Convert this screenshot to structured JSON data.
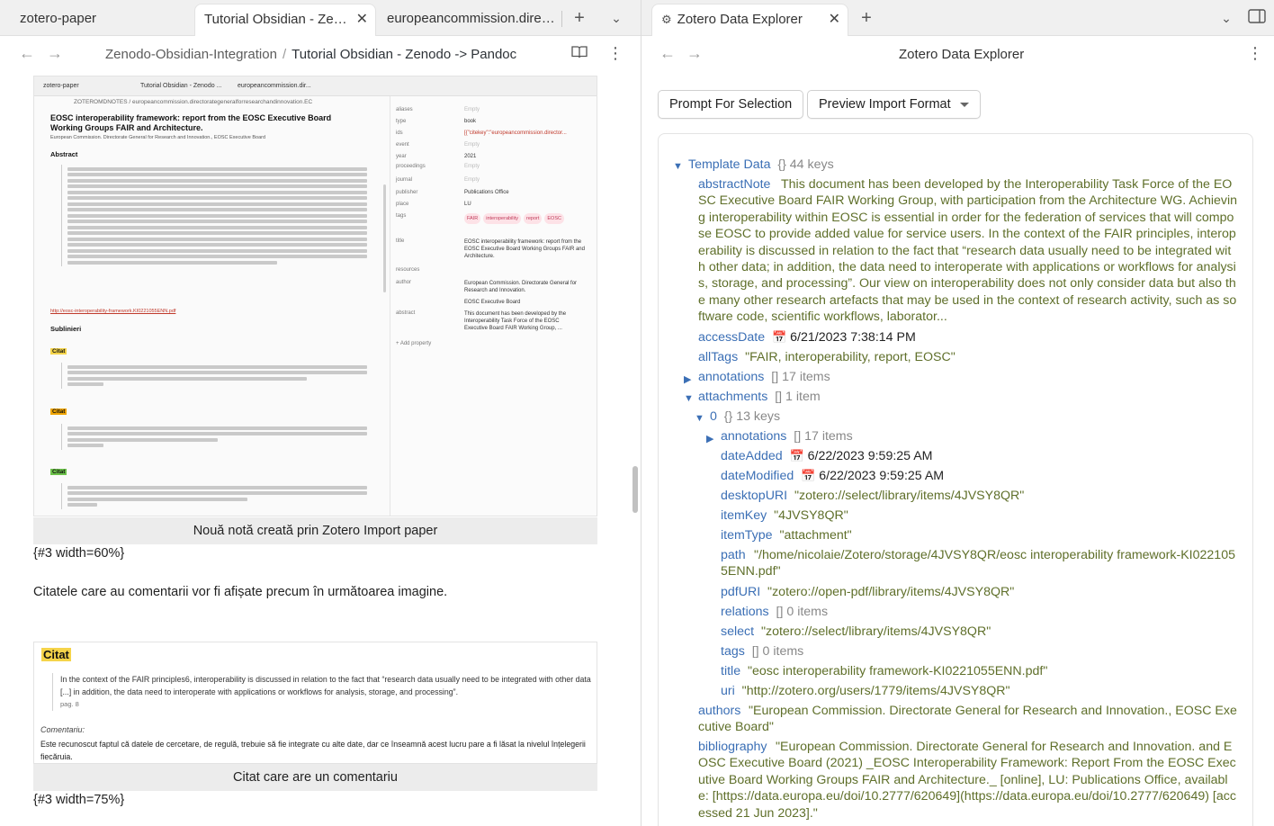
{
  "left": {
    "tabs": [
      {
        "label": "zotero-paper"
      },
      {
        "label": "Tutorial Obsidian - Zenodo -> Pandoc"
      },
      {
        "label": "europeancommission.directorategeneralforresearchandinnovation"
      }
    ],
    "breadcrumb": {
      "folder": "Zenodo-Obsidian-Integration",
      "separator": "/",
      "note": "Tutorial Obsidian - Zenodo -> Pandoc"
    },
    "mini": {
      "tabs": [
        "zotero-paper",
        "Tutorial Obsidian - Zenodo ...",
        "europeancommission.dir..."
      ],
      "crumb": "ZOTEROMDNOTES / europeancommission.directorategeneralforresearchandinnovation.EC",
      "title": "EOSC interoperability framework: report from the EOSC Executive Board Working Groups FAIR and Architecture.",
      "authors": "European Commission. Directorate General for Research and Innovation., EOSC Executive Board",
      "abstract_h": "Abstract",
      "link": "http://eosc-interoperability-framework.KI0221055ENN.pdf",
      "sublinieri": "Sublinieri",
      "citat": "Citat",
      "props": [
        {
          "name": "aliases",
          "value": "Empty"
        },
        {
          "name": "type",
          "value": "book"
        },
        {
          "name": "ids",
          "value": "[{\"citekey\":\"europeancommission.director..."
        },
        {
          "name": "event",
          "value": "Empty"
        },
        {
          "name": "year",
          "value": "2021"
        },
        {
          "name": "proceedings",
          "value": "Empty"
        },
        {
          "name": "journal",
          "value": "Empty"
        },
        {
          "name": "publisher",
          "value": "Publications Office"
        },
        {
          "name": "place",
          "value": "LU"
        },
        {
          "name": "tags",
          "value": ""
        },
        {
          "name": "title",
          "value": "EOSC interoperability framework: report from the EOSC Executive Board Working Groups FAIR and Architecture."
        },
        {
          "name": "resources",
          "value": ""
        },
        {
          "name": "author",
          "value": "European Commission. Directorate General for Research and Innovation."
        },
        {
          "name": "abstract",
          "value": "This document has been developed by the Interoperability Task Force of the EOSC Executive Board FAIR Working Group, ..."
        }
      ],
      "tags": [
        "FAIR",
        "interoperability",
        "report",
        "EOSC"
      ],
      "author2": "EOSC Executive Board",
      "add_property": "+ Add property"
    },
    "caption1": "Nouă notă creată prin Zotero Import paper",
    "width1": "{#3 width=60%}",
    "paragraph": "Citatele care au comentarii vor fi afișate precum în următoarea imagine.",
    "quote_card": {
      "label": "Citat",
      "text": "In the context of the FAIR principles6, interoperability is discussed in relation to the fact that “research data usually need to be integrated with other data [...] in addition, the data need to interoperate with applications or workflows for analysis, storage, and processing”.",
      "page": "pag. 8",
      "comment_label": "Comentariu:",
      "comment": "Este recunoscut faptul că datele de cercetare, de regulă, trebuie să fie integrate cu alte date, dar ce înseamnă acest lucru pare a fi lăsat la nivelul înțelegerii fiecăruia."
    },
    "caption2": "Citat care are un comentariu",
    "width2": "{#3 width=75%}"
  },
  "right": {
    "tab": {
      "label": "Zotero Data Explorer"
    },
    "title": "Zotero Data Explorer",
    "buttons": {
      "prompt": "Prompt For Selection",
      "preview": "Preview Import Format"
    },
    "tree": {
      "root_key": "Template Data",
      "root_meta": "{}  44 keys",
      "abstractNote_key": "abstractNote",
      "abstractNote_val": "This document has been developed by the Interoperability Task Force of the EOSC Executive Board FAIR Working Group, with participation from the Architecture WG. Achieving interoperability within EOSC is essential in order for the federation of services that will compose EOSC to provide added value for service users. In the context of the FAIR principles, interoperability is discussed in relation to the fact that “research data usually need to be integrated with other data; in addition, the data need to interoperate with applications or workflows for analysis, storage, and processing”. Our view on interoperability does not only consider data but also the many other research artefacts that may be used in the context of research activity, such as software code, scientific workflows, laborator...",
      "accessDate_key": "accessDate",
      "accessDate_val": "6/21/2023 7:38:14 PM",
      "allTags_key": "allTags",
      "allTags_val": "\"FAIR, interoperability, report, EOSC\"",
      "annotations_key": "annotations",
      "annotations_meta": "[]  17 items",
      "attachments_key": "attachments",
      "attachments_meta": "[]  1 item",
      "att0_key": "0",
      "att0_meta": "{}  13 keys",
      "a_annotations_key": "annotations",
      "a_annotations_meta": "[]  17 items",
      "dateAdded_key": "dateAdded",
      "dateAdded_val": "6/22/2023 9:59:25 AM",
      "dateModified_key": "dateModified",
      "dateModified_val": "6/22/2023 9:59:25 AM",
      "desktopURI_key": "desktopURI",
      "desktopURI_val": "\"zotero://select/library/items/4JVSY8QR\"",
      "itemKey_key": "itemKey",
      "itemKey_val": "\"4JVSY8QR\"",
      "itemType_key": "itemType",
      "itemType_val": "\"attachment\"",
      "path_key": "path",
      "path_val": "\"/home/nicolaie/Zotero/storage/4JVSY8QR/eosc interoperability framework-KI0221055ENN.pdf\"",
      "pdfURI_key": "pdfURI",
      "pdfURI_val": "\"zotero://open-pdf/library/items/4JVSY8QR\"",
      "relations_key": "relations",
      "relations_meta": "[]  0 items",
      "select_key": "select",
      "select_val": "\"zotero://select/library/items/4JVSY8QR\"",
      "tags_key": "tags",
      "tags_meta": "[]  0 items",
      "title_key": "title",
      "title_val": "\"eosc interoperability framework-KI0221055ENN.pdf\"",
      "uri_key": "uri",
      "uri_val": "\"http://zotero.org/users/1779/items/4JVSY8QR\"",
      "authors_key": "authors",
      "authors_val": "\"European Commission. Directorate General for Research and Innovation., EOSC Executive Board\"",
      "bibliography_key": "bibliography",
      "bibliography_val": "\"European Commission. Directorate General for Research and Innovation. and EOSC Executive Board (2021) _EOSC Interoperability Framework: Report From the EOSC Executive Board Working Groups FAIR and Architecture._ [online], LU: Publications Office, available: [https://data.europa.eu/doi/10.2777/620649](https://data.europa.eu/doi/10.2777/620649) [accessed 21 Jun 2023].\""
    }
  },
  "colors": {
    "key": "#3b6fb5",
    "value": "#5f6f2a",
    "highlight_yellow": "#f5d44a",
    "highlight_orange": "#f0a500",
    "highlight_green": "#6cc24a",
    "tag_bg": "#fde2e7"
  }
}
